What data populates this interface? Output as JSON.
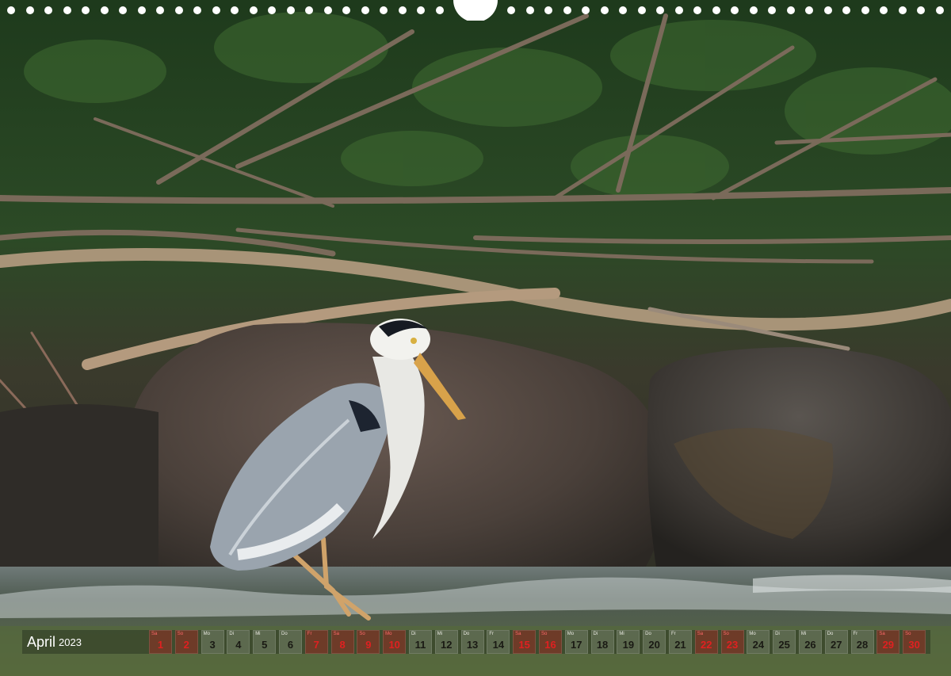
{
  "calendar": {
    "month": "April",
    "year": "2023",
    "days": [
      {
        "wd": "Sa",
        "num": "1",
        "red": true
      },
      {
        "wd": "So",
        "num": "2",
        "red": true
      },
      {
        "wd": "Mo",
        "num": "3",
        "red": false
      },
      {
        "wd": "Di",
        "num": "4",
        "red": false
      },
      {
        "wd": "Mi",
        "num": "5",
        "red": false
      },
      {
        "wd": "Do",
        "num": "6",
        "red": false
      },
      {
        "wd": "Fr",
        "num": "7",
        "red": true
      },
      {
        "wd": "Sa",
        "num": "8",
        "red": true
      },
      {
        "wd": "So",
        "num": "9",
        "red": true
      },
      {
        "wd": "Mo",
        "num": "10",
        "red": true
      },
      {
        "wd": "Di",
        "num": "11",
        "red": false
      },
      {
        "wd": "Mi",
        "num": "12",
        "red": false
      },
      {
        "wd": "Do",
        "num": "13",
        "red": false
      },
      {
        "wd": "Fr",
        "num": "14",
        "red": false
      },
      {
        "wd": "Sa",
        "num": "15",
        "red": true
      },
      {
        "wd": "So",
        "num": "16",
        "red": true
      },
      {
        "wd": "Mo",
        "num": "17",
        "red": false
      },
      {
        "wd": "Di",
        "num": "18",
        "red": false
      },
      {
        "wd": "Mi",
        "num": "19",
        "red": false
      },
      {
        "wd": "Do",
        "num": "20",
        "red": false
      },
      {
        "wd": "Fr",
        "num": "21",
        "red": false
      },
      {
        "wd": "Sa",
        "num": "22",
        "red": true
      },
      {
        "wd": "So",
        "num": "23",
        "red": true
      },
      {
        "wd": "Mo",
        "num": "24",
        "red": false
      },
      {
        "wd": "Di",
        "num": "25",
        "red": false
      },
      {
        "wd": "Mi",
        "num": "26",
        "red": false
      },
      {
        "wd": "Do",
        "num": "27",
        "red": false
      },
      {
        "wd": "Fr",
        "num": "28",
        "red": false
      },
      {
        "wd": "Sa",
        "num": "29",
        "red": true
      },
      {
        "wd": "So",
        "num": "30",
        "red": true
      }
    ]
  },
  "colors": {
    "holiday": "#e02020",
    "workday": "#1a1a14"
  },
  "icons": [
    "binding-holes",
    "hanger-hole"
  ]
}
